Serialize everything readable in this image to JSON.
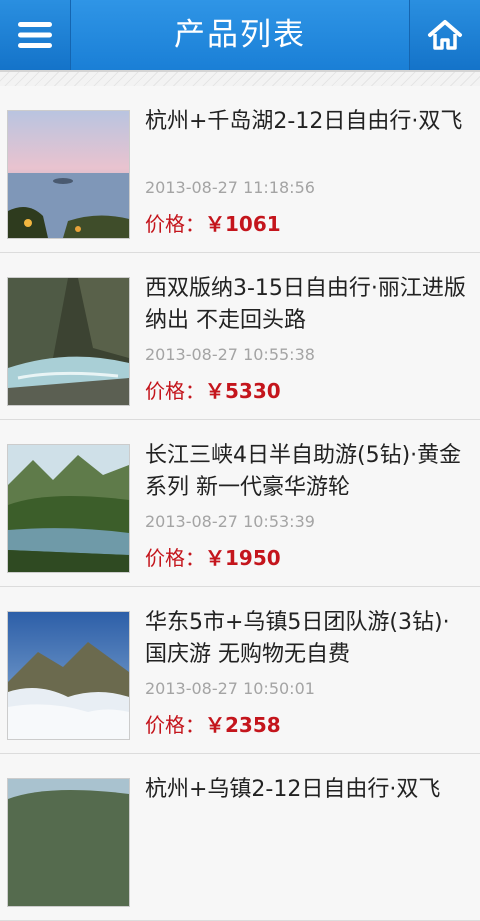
{
  "header": {
    "title": "产品列表",
    "menu_icon": "menu-icon",
    "home_icon": "home-icon"
  },
  "products": [
    {
      "name": "杭州+千岛湖2-12日自由行·双飞",
      "date": "2013-08-27 11:18:56",
      "price_label": "价格：",
      "price": "￥1061"
    },
    {
      "name": "西双版纳3-15日自由行·丽江进版纳出 不走回头路",
      "date": "2013-08-27 10:55:38",
      "price_label": "价格：",
      "price": "￥5330"
    },
    {
      "name": "长江三峡4日半自助游(5钻)·黄金系列 新一代豪华游轮",
      "date": "2013-08-27 10:53:39",
      "price_label": "价格：",
      "price": "￥1950"
    },
    {
      "name": "华东5市+乌镇5日团队游(3钻)·国庆游 无购物无自费",
      "date": "2013-08-27 10:50:01",
      "price_label": "价格：",
      "price": "￥2358"
    },
    {
      "name": "杭州+乌镇2-12日自由行·双飞",
      "date": "",
      "price_label": "",
      "price": ""
    }
  ],
  "colors": {
    "header": "#1f86db",
    "price": "#c4151c"
  }
}
